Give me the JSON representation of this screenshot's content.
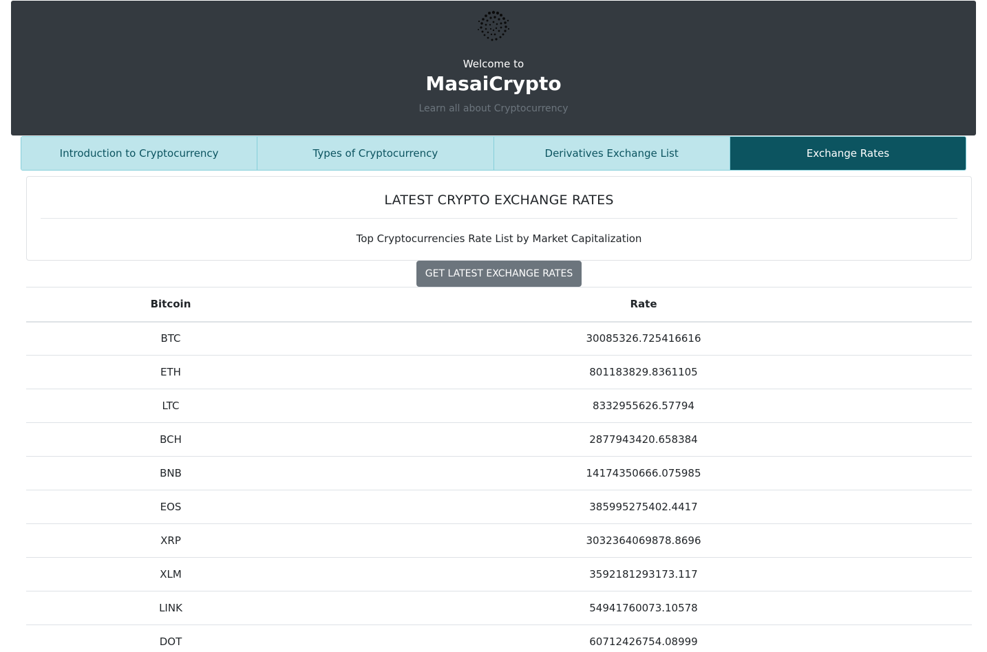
{
  "header": {
    "welcome": "Welcome to",
    "brand": "MasaiCrypto",
    "tagline": "Learn all about Cryptocurrency",
    "logo_icon": "iota-logo-icon"
  },
  "tabs": [
    {
      "label": "Introduction to Cryptocurrency",
      "active": false
    },
    {
      "label": "Types of Cryptocurrency",
      "active": false
    },
    {
      "label": "Derivatives Exchange List",
      "active": false
    },
    {
      "label": "Exchange Rates",
      "active": true
    }
  ],
  "card": {
    "title": "LATEST CRYPTO EXCHANGE RATES",
    "subtitle": "Top Cryptocurrencies Rate List by Market Capitalization"
  },
  "button": {
    "label": "GET LATEST EXCHANGE RATES"
  },
  "table": {
    "headers": [
      "Bitcoin",
      "Rate"
    ],
    "rows": [
      {
        "symbol": "BTC",
        "rate": "30085326.725416616"
      },
      {
        "symbol": "ETH",
        "rate": "801183829.8361105"
      },
      {
        "symbol": "LTC",
        "rate": "8332955626.57794"
      },
      {
        "symbol": "BCH",
        "rate": "2877943420.658384"
      },
      {
        "symbol": "BNB",
        "rate": "14174350666.075985"
      },
      {
        "symbol": "EOS",
        "rate": "385995275402.4417"
      },
      {
        "symbol": "XRP",
        "rate": "3032364069878.8696"
      },
      {
        "symbol": "XLM",
        "rate": "3592181293173.117"
      },
      {
        "symbol": "LINK",
        "rate": "54941760073.10578"
      },
      {
        "symbol": "DOT",
        "rate": "60712426754.08999"
      }
    ]
  },
  "colors": {
    "header_bg": "#343a40",
    "tab_bg": "#bee5eb",
    "tab_text": "#0c5460",
    "tab_active_bg": "#0c5460",
    "button_bg": "#6c757d"
  }
}
